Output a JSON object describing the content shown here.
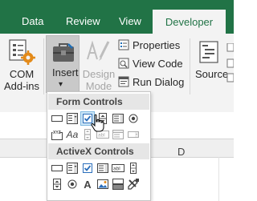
{
  "tabs": [
    {
      "label": "Data",
      "active": false
    },
    {
      "label": "Review",
      "active": false
    },
    {
      "label": "View",
      "active": false
    },
    {
      "label": "Developer",
      "active": true
    }
  ],
  "ribbon": {
    "com_addins": {
      "line1": "COM",
      "line2": "Add-ins"
    },
    "insert": {
      "label": "Insert",
      "chevron": "▾"
    },
    "design_mode": {
      "line1": "Design",
      "line2": "Mode",
      "enabled": false
    },
    "properties": "Properties",
    "view_code": "View Code",
    "run_dialog": "Run Dialog",
    "source": "Source"
  },
  "popup": {
    "form_controls_header": "Form Controls",
    "activex_controls_header": "ActiveX Controls",
    "form_controls": [
      {
        "icon": "button-icon"
      },
      {
        "icon": "combo-box-icon"
      },
      {
        "icon": "checkbox-icon",
        "hovered": true
      },
      {
        "icon": "spin-button-icon"
      },
      {
        "icon": "list-box-icon"
      },
      {
        "icon": "option-button-icon"
      },
      {
        "icon": "group-box-icon",
        "glyph": "XYZ"
      },
      {
        "icon": "label-icon",
        "glyph": "Aa"
      },
      {
        "icon": "scroll-bar-icon",
        "enabled": false
      },
      {
        "icon": "text-field-icon",
        "glyph": "abl",
        "enabled": false
      },
      {
        "icon": "combo-list-edit-icon",
        "enabled": false
      },
      {
        "icon": "combo-drop-down-edit-icon",
        "enabled": false
      }
    ],
    "activex_controls": [
      {
        "icon": "command-button-icon"
      },
      {
        "icon": "combo-box-icon"
      },
      {
        "icon": "checkbox-icon"
      },
      {
        "icon": "list-box-icon"
      },
      {
        "icon": "text-box-icon",
        "glyph": "abl"
      },
      {
        "icon": "scroll-bar-icon"
      },
      {
        "icon": "spin-button-icon"
      },
      {
        "icon": "option-button-icon"
      },
      {
        "icon": "label-icon",
        "glyph": "A"
      },
      {
        "icon": "image-icon"
      },
      {
        "icon": "toggle-button-icon"
      },
      {
        "icon": "more-controls-icon"
      }
    ]
  },
  "sheet": {
    "column_letter": "D"
  },
  "colors": {
    "accent": "#217346",
    "ribbon_bg": "#f3f3f3",
    "hover": "#cde6f7"
  }
}
